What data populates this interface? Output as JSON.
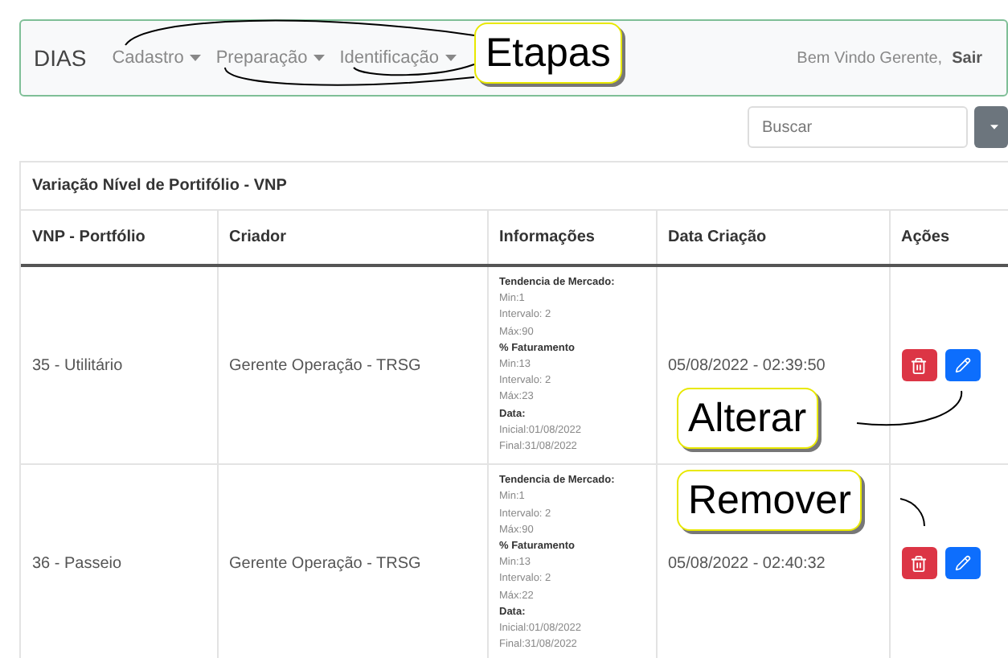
{
  "navbar": {
    "brand": "DIAS",
    "menus": [
      {
        "label": "Cadastro"
      },
      {
        "label": "Preparação"
      },
      {
        "label": "Identificação"
      }
    ],
    "greeting": "Bem Vindo Gerente,",
    "logout": "Sair"
  },
  "search": {
    "placeholder": "Buscar"
  },
  "card": {
    "title": "Variação Nível de Portifólio - VNP"
  },
  "table": {
    "columns": [
      "VNP - Portfólio",
      "Criador",
      "Informações",
      "Data Criação",
      "Ações"
    ],
    "rows": [
      {
        "portfolio": "35 - Utilitário",
        "creator": "Gerente Operação - TRSG",
        "date": "05/08/2022 - 02:39:50",
        "info": [
          {
            "kind": "heading",
            "text": "Tendencia de Mercado:"
          },
          {
            "kind": "value",
            "text": "Min:1"
          },
          {
            "kind": "value",
            "text": "Intervalo: 2"
          },
          {
            "kind": "value",
            "text": "Máx:90"
          },
          {
            "kind": "heading",
            "text": "% Faturamento"
          },
          {
            "kind": "value",
            "text": "Min:13"
          },
          {
            "kind": "value",
            "text": "Intervalo: 2"
          },
          {
            "kind": "value",
            "text": "Máx:23"
          },
          {
            "kind": "heading",
            "text": "Data:"
          },
          {
            "kind": "value",
            "text": "Inicial:01/08/2022"
          },
          {
            "kind": "value",
            "text": "Final:31/08/2022"
          }
        ]
      },
      {
        "portfolio": "36 - Passeio",
        "creator": "Gerente Operação - TRSG",
        "date": "05/08/2022 - 02:40:32",
        "info": [
          {
            "kind": "heading",
            "text": "Tendencia de Mercado:"
          },
          {
            "kind": "value",
            "text": "Min:1"
          },
          {
            "kind": "value",
            "text": "Intervalo: 2"
          },
          {
            "kind": "value",
            "text": "Máx:90"
          },
          {
            "kind": "heading",
            "text": "% Faturamento"
          },
          {
            "kind": "value",
            "text": "Min:13"
          },
          {
            "kind": "value",
            "text": "Intervalo: 2"
          },
          {
            "kind": "value",
            "text": "Máx:22"
          },
          {
            "kind": "heading",
            "text": "Data:"
          },
          {
            "kind": "value",
            "text": "Inicial:01/08/2022"
          },
          {
            "kind": "value",
            "text": "Final:31/08/2022"
          }
        ]
      }
    ]
  },
  "callouts": [
    {
      "label": "Etapas"
    },
    {
      "label": "Alterar"
    },
    {
      "label": "Remover"
    }
  ]
}
